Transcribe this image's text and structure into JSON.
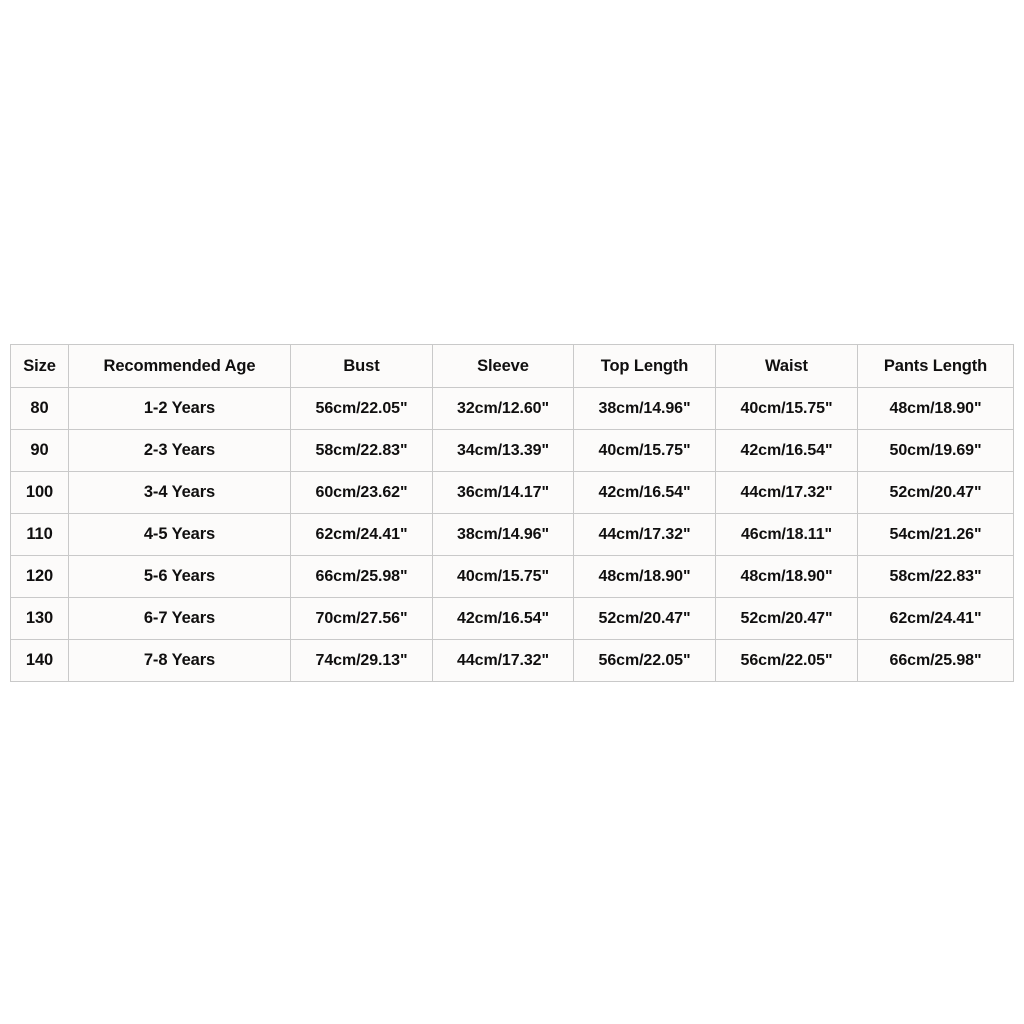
{
  "chart_data": {
    "type": "table",
    "title": "",
    "columns": [
      "Size",
      "Recommended Age",
      "Bust",
      "Sleeve",
      "Top Length",
      "Waist",
      "Pants Length"
    ],
    "rows": [
      [
        "80",
        "1-2 Years",
        "56cm/22.05\"",
        "32cm/12.60\"",
        "38cm/14.96\"",
        "40cm/15.75\"",
        "48cm/18.90\""
      ],
      [
        "90",
        "2-3 Years",
        "58cm/22.83\"",
        "34cm/13.39\"",
        "40cm/15.75\"",
        "42cm/16.54\"",
        "50cm/19.69\""
      ],
      [
        "100",
        "3-4 Years",
        "60cm/23.62\"",
        "36cm/14.17\"",
        "42cm/16.54\"",
        "44cm/17.32\"",
        "52cm/20.47\""
      ],
      [
        "110",
        "4-5 Years",
        "62cm/24.41\"",
        "38cm/14.96\"",
        "44cm/17.32\"",
        "46cm/18.11\"",
        "54cm/21.26\""
      ],
      [
        "120",
        "5-6 Years",
        "66cm/25.98\"",
        "40cm/15.75\"",
        "48cm/18.90\"",
        "48cm/18.90\"",
        "58cm/22.83\""
      ],
      [
        "130",
        "6-7 Years",
        "70cm/27.56\"",
        "42cm/16.54\"",
        "52cm/20.47\"",
        "52cm/20.47\"",
        "62cm/24.41\""
      ],
      [
        "140",
        "7-8 Years",
        "74cm/29.13\"",
        "44cm/17.32\"",
        "56cm/22.05\"",
        "56cm/22.05\"",
        "66cm/25.98\""
      ]
    ]
  },
  "table": {
    "headers": {
      "size": "Size",
      "age": "Recommended Age",
      "bust": "Bust",
      "sleeve": "Sleeve",
      "top_length": "Top Length",
      "waist": "Waist",
      "pants_length": "Pants Length"
    },
    "rows": [
      {
        "size": "80",
        "age": "1-2 Years",
        "bust": "56cm/22.05\"",
        "sleeve": "32cm/12.60\"",
        "top_length": "38cm/14.96\"",
        "waist": "40cm/15.75\"",
        "pants_length": "48cm/18.90\""
      },
      {
        "size": "90",
        "age": "2-3 Years",
        "bust": "58cm/22.83\"",
        "sleeve": "34cm/13.39\"",
        "top_length": "40cm/15.75\"",
        "waist": "42cm/16.54\"",
        "pants_length": "50cm/19.69\""
      },
      {
        "size": "100",
        "age": "3-4 Years",
        "bust": "60cm/23.62\"",
        "sleeve": "36cm/14.17\"",
        "top_length": "42cm/16.54\"",
        "waist": "44cm/17.32\"",
        "pants_length": "52cm/20.47\""
      },
      {
        "size": "110",
        "age": "4-5 Years",
        "bust": "62cm/24.41\"",
        "sleeve": "38cm/14.96\"",
        "top_length": "44cm/17.32\"",
        "waist": "46cm/18.11\"",
        "pants_length": "54cm/21.26\""
      },
      {
        "size": "120",
        "age": "5-6 Years",
        "bust": "66cm/25.98\"",
        "sleeve": "40cm/15.75\"",
        "top_length": "48cm/18.90\"",
        "waist": "48cm/18.90\"",
        "pants_length": "58cm/22.83\""
      },
      {
        "size": "130",
        "age": "6-7 Years",
        "bust": "70cm/27.56\"",
        "sleeve": "42cm/16.54\"",
        "top_length": "52cm/20.47\"",
        "waist": "52cm/20.47\"",
        "pants_length": "62cm/24.41\""
      },
      {
        "size": "140",
        "age": "7-8 Years",
        "bust": "74cm/29.13\"",
        "sleeve": "44cm/17.32\"",
        "top_length": "56cm/22.05\"",
        "waist": "56cm/22.05\"",
        "pants_length": "66cm/25.98\""
      }
    ]
  },
  "colors": {
    "background": "#ffffff",
    "cell_background": "#fcfbfa",
    "border": "#c9c9c9",
    "text": "#100f0f"
  }
}
